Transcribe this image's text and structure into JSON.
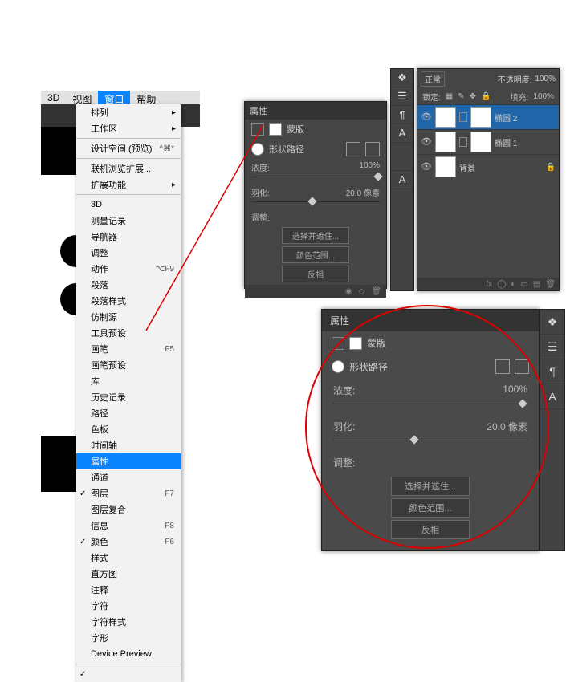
{
  "menubar": {
    "items": [
      "3D",
      "视图",
      "窗口",
      "帮助"
    ],
    "activeIndex": 2
  },
  "menu": {
    "arrange": "排列",
    "workspace": "工作区",
    "designSpace": "设计空间 (预览)",
    "designSpaceShortcut": "^⌘*",
    "browseExt": "联机浏览扩展...",
    "extensions": "扩展功能",
    "items3d": "3D",
    "measureLog": "测量记录",
    "navigator": "导航器",
    "adjustments": "调整",
    "actions": "动作",
    "actionsShortcut": "⌥F9",
    "paragraph": "段落",
    "paraStyles": "段落样式",
    "cloneSource": "仿制源",
    "toolPresets": "工具预设",
    "brush": "画笔",
    "brushShortcut": "F5",
    "brushPresets": "画笔预设",
    "libraries": "库",
    "history": "历史记录",
    "paths": "路径",
    "swatches": "色板",
    "timeline": "时间轴",
    "properties": "属性",
    "channels": "通道",
    "layers": "图层",
    "layersShortcut": "F7",
    "layerComps": "图层复合",
    "info": "信息",
    "infoShortcut": "F8",
    "color": "颜色",
    "colorShortcut": "F6",
    "styles": "样式",
    "histogram": "直方图",
    "notes": "注释",
    "character": "字符",
    "charStyles": "字符样式",
    "glyphs": "字形",
    "devicePreview": "Device Preview"
  },
  "props": {
    "title": "属性",
    "maskTab": "蒙版",
    "modeLabel": "形状路径",
    "density": "浓度:",
    "densityValue": "100%",
    "feather": "羽化:",
    "featherValue": "20.0 像素",
    "adjust": "调整:",
    "btnSelect": "选择并遮住...",
    "btnColorRange": "颜色范围...",
    "btnInvert": "反相"
  },
  "iconsStrip": [
    "❖",
    "☰",
    "¶",
    "A",
    "A"
  ],
  "layersPanel": {
    "mode": "正常",
    "opacityLabel": "不透明度:",
    "opacity": "100%",
    "lockLabel": "锁定:",
    "fillLabel": "填充:",
    "fill": "100%",
    "layers": [
      {
        "name": "椭圆 2"
      },
      {
        "name": "椭圆 1"
      },
      {
        "name": "背景"
      }
    ]
  }
}
